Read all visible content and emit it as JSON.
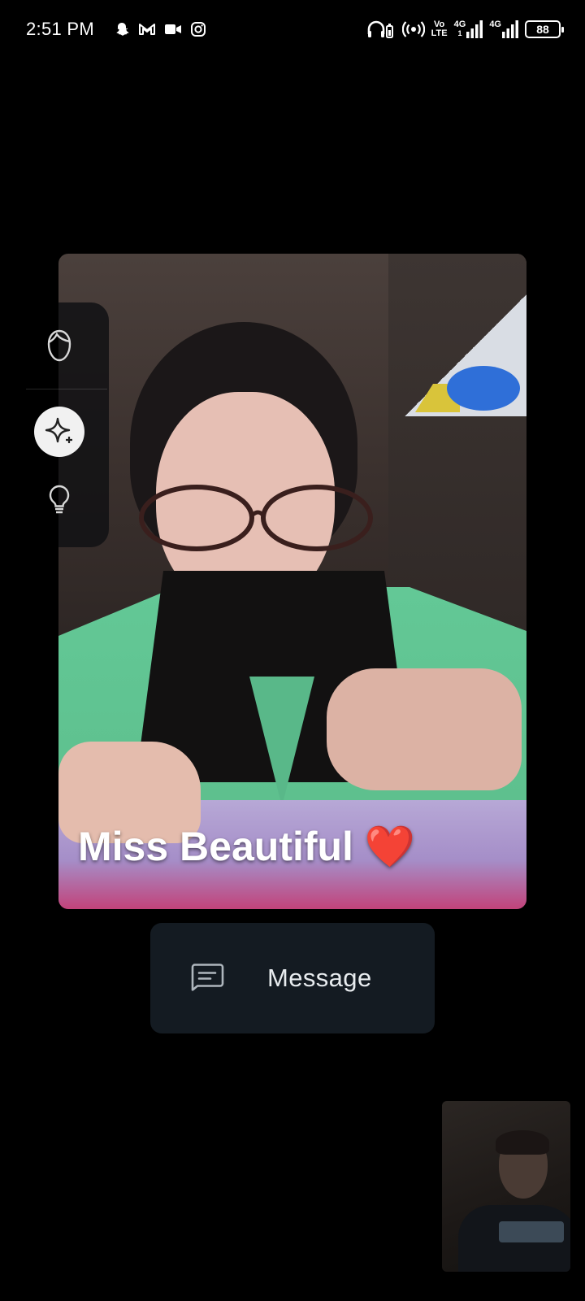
{
  "status_bar": {
    "time": "2:51 PM",
    "notification_icons": [
      "snapchat-icon",
      "gmail-icon",
      "video-camera-icon",
      "instagram-icon"
    ],
    "system_icons": [
      "headphones-battery-icon",
      "hotspot-icon"
    ],
    "volte_line1": "Vo",
    "volte_line2": "LTE",
    "sim1_network": "4G",
    "sim1_sub": "1",
    "sim2_network": "4G",
    "battery_level": "88"
  },
  "call": {
    "remote_name": "Miss Beautiful ❤️",
    "effects_panel": [
      "face-filter-icon",
      "sparkle-effects-icon",
      "lightbulb-icon"
    ],
    "effects_selected": "sparkle-effects-icon",
    "message_button_label": "Message",
    "message_icon": "message-icon"
  },
  "colors": {
    "background": "#000000",
    "message_button_bg": "#141b22",
    "effects_selected_bg": "#f1f1f1"
  }
}
